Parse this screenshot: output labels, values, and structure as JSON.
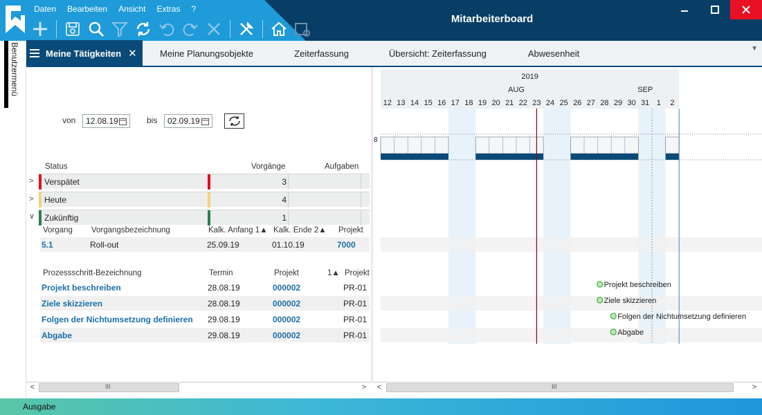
{
  "app": {
    "title": "Mitarbeiterboard",
    "menu": [
      "Daten",
      "Bearbeiten",
      "Ansicht",
      "Extras",
      "?"
    ],
    "toolbar_icons": [
      "add-icon",
      "save-icon",
      "search-icon",
      "filter-icon",
      "refresh-icon",
      "undo-icon",
      "redo-icon",
      "cancel-icon",
      "tools-icon",
      "home-icon",
      "calendar-settings-icon"
    ]
  },
  "window_controls": [
    "minimize-icon",
    "maximize-icon",
    "close-icon"
  ],
  "side_menu": {
    "label": "Benutzermenü"
  },
  "tabs": {
    "active": "Meine Tätigkeiten",
    "others": [
      "Meine Planungsobjekte",
      "Zeiterfassung",
      "Übersicht: Zeiterfassung",
      "Abwesenheit"
    ]
  },
  "filter": {
    "von_label": "von",
    "von_value": "12.08.19",
    "bis_label": "bis",
    "bis_value": "02.09.19"
  },
  "status_table": {
    "headers": {
      "status": "Status",
      "vorgaenge": "Vorgänge",
      "aufgaben": "Aufgaben"
    },
    "rows": [
      {
        "name": "Verspätet",
        "count": "3",
        "color": "#e0101e"
      },
      {
        "name": "Heute",
        "count": "4",
        "color": "#f4d27a"
      },
      {
        "name": "Zukünftig",
        "count": "1",
        "color": "#2e7d4f"
      }
    ]
  },
  "vorgang_table": {
    "headers": {
      "vorgang": "Vorgang",
      "bezeichnung": "Vorgangsbezeichnung",
      "anfang": "Kalk. Anfang",
      "anfang_sort": "1",
      "ende": "Kalk. Ende",
      "ende_sort": "2",
      "projekt": "Projekt"
    },
    "rows": [
      {
        "vorgang": "5.1",
        "bezeichnung": "Roll-out",
        "anfang": "25.09.19",
        "ende": "01.10.19",
        "projekt": "7000"
      }
    ]
  },
  "process_table": {
    "headers": {
      "bezeichnung": "Prozessschritt-Bezeichnung",
      "termin": "Termin",
      "projekt": "Projekt",
      "sort": "1",
      "projekt2": "Projekt"
    },
    "rows": [
      {
        "bezeichnung": "Projekt beschreiben",
        "termin": "28.08.19",
        "projekt": "000002",
        "projekt2": "PR-01"
      },
      {
        "bezeichnung": "Ziele skizzieren",
        "termin": "28.08.19",
        "projekt": "000002",
        "projekt2": "PR-01"
      },
      {
        "bezeichnung": "Folgen der Nichtumsetzung definieren",
        "termin": "29.08.19",
        "projekt": "000002",
        "projekt2": "PR-01"
      },
      {
        "bezeichnung": "Abgabe",
        "termin": "29.08.19",
        "projekt": "000002",
        "projekt2": "PR-01"
      }
    ]
  },
  "gantt": {
    "year": "2019",
    "months": [
      {
        "label": "AUG",
        "start_day": "12"
      },
      {
        "label": "SEP",
        "start_day": "1"
      }
    ],
    "days": [
      "12",
      "13",
      "14",
      "15",
      "16",
      "17",
      "18",
      "19",
      "20",
      "21",
      "22",
      "23",
      "24",
      "25",
      "26",
      "27",
      "28",
      "29",
      "30",
      "31",
      "1",
      "2"
    ],
    "weekend_days": [
      "17",
      "18",
      "24",
      "25",
      "31",
      "1"
    ],
    "today_day": "23",
    "capacity_label": "8",
    "milestones": [
      {
        "label": "Projekt beschreiben",
        "day": "28"
      },
      {
        "label": "Ziele skizzieren",
        "day": "28"
      },
      {
        "label": "Folgen der Nichtumsetzung definieren",
        "day": "29"
      },
      {
        "label": "Abgabe",
        "day": "29"
      }
    ],
    "colors": {
      "weekend": "#e8f2fb",
      "today_line": "#7a0a1a",
      "bar": "#0a4a78",
      "milestone": "#3cb043"
    }
  },
  "status_bar": {
    "text": "Ausgabe"
  }
}
